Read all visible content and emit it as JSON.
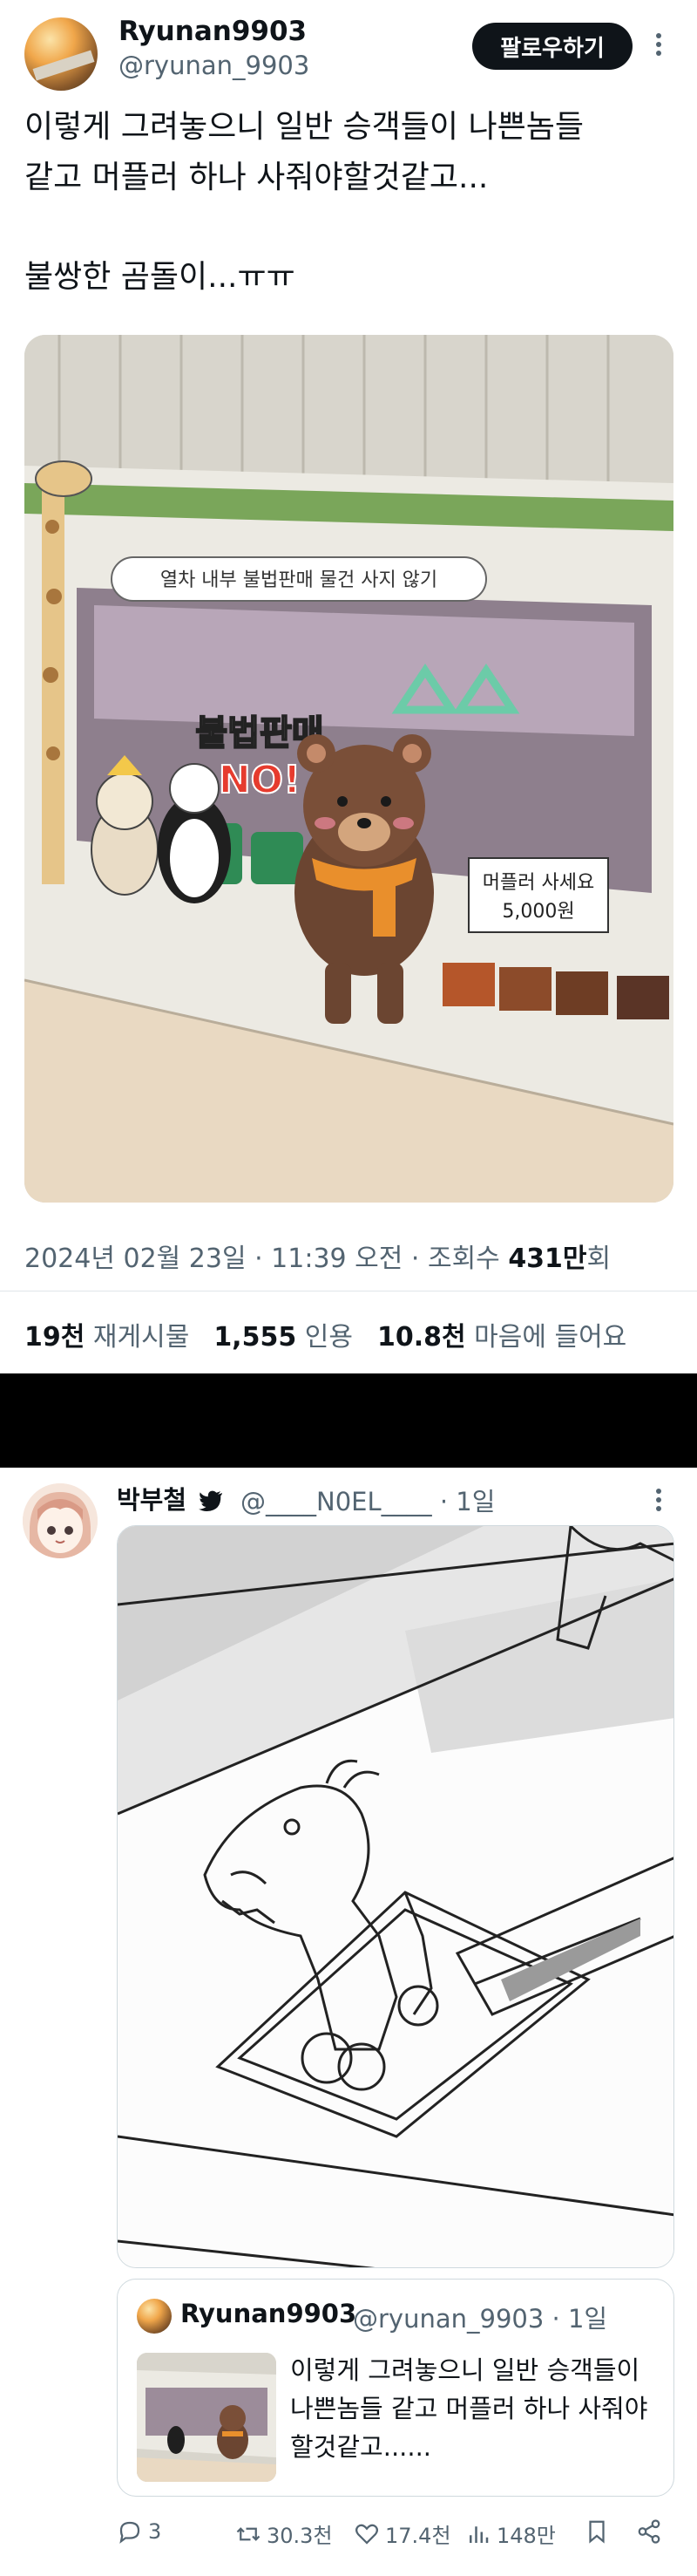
{
  "tweet1": {
    "display_name": "Ryunan9903",
    "handle": "@ryunan_9903",
    "follow_label": "팔로우하기",
    "text_line1": "이렇게 그려놓으니 일반 승객들이 나쁜놈들",
    "text_line2": "같고 머플러 하나 사줘야할것같고...",
    "text_line3": "불쌍한 곰돌이...ㅠㅠ",
    "photo": {
      "banner_text": "열차 내부 불법판매 물건 사지 않기",
      "sign_title": "불법판매",
      "sign_no": "NO!",
      "price_line1": "머플러 사세요",
      "price_line2": "5,000원"
    },
    "timestamp": "2024년 02월 23일 · 11:39 오전 · 조회수 ",
    "views": "431만",
    "views_suffix": "회",
    "retweets_count": "19천",
    "retweets_label": "재게시물",
    "quotes_count": "1,555",
    "quotes_label": "인용",
    "likes_count": "10.8천",
    "likes_label": "마음에 들어요"
  },
  "tweet2": {
    "display_name": "박부철",
    "handle": "@____N0EL____ · 1일",
    "quote": {
      "display_name": "Ryunan9903",
      "handle": "@ryunan_9903 · 1일",
      "text": "이렇게 그려놓으니 일반 승객들이 나쁜놈들 같고 머플러 하나 사줘야할것같고......"
    },
    "actions": {
      "replies": "3",
      "retweets": "30.3천",
      "likes": "17.4천",
      "views": "148만"
    }
  },
  "colors": {
    "text_primary": "#0f1419",
    "text_secondary": "#536471",
    "border": "#cfd9de"
  }
}
